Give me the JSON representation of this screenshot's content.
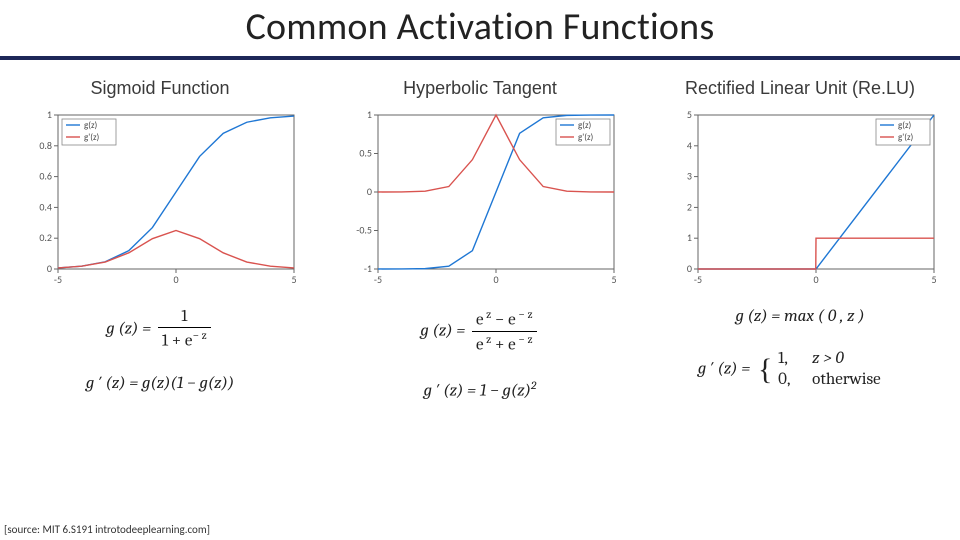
{
  "title": "Common Activation Functions",
  "source": "[source: MIT 6.S191 introtodeeplearning.com]",
  "legend": {
    "g": "g(z)",
    "gp": "g'(z)"
  },
  "panels": {
    "sigmoid": {
      "title": "Sigmoid Function",
      "formula_g_lhs": "g (z) = ",
      "formula_g_num": "1",
      "formula_g_den_pre": "1 + e",
      "formula_g_den_sup": "− z",
      "formula_gp": "g ′ (z) =  g(z)(1 − g(z))"
    },
    "tanh": {
      "title": "Hyperbolic Tangent",
      "formula_g_lhs": "g (z) = ",
      "formula_g_num_a": "e",
      "formula_g_num_a_sup": " z",
      "formula_g_num_mid": " − e",
      "formula_g_num_b_sup": " − z",
      "formula_g_den_a": "e",
      "formula_g_den_a_sup": " z",
      "formula_g_den_mid": " + e",
      "formula_g_den_b_sup": " − z",
      "formula_gp_pre": "g ′ (z) =  1 − g(z)",
      "formula_gp_sup": "2"
    },
    "relu": {
      "title": "Rectified Linear Unit (Re.LU)",
      "formula_g": "g (z) =  max ( 0 , z )",
      "formula_gp_lhs": "g ′ (z) = ",
      "cases_1_val": "1,",
      "cases_1_cond": "z > 0",
      "cases_0_val": "0,",
      "cases_0_cond": "otherwise"
    }
  },
  "chart_data": [
    {
      "type": "line",
      "title": "Sigmoid Function",
      "xlabel": "",
      "ylabel": "",
      "xlim": [
        -5,
        5
      ],
      "ylim": [
        0,
        1
      ],
      "xticks": [
        -5,
        0,
        5
      ],
      "yticks": [
        0,
        0.2,
        0.4,
        0.6,
        0.8,
        1
      ],
      "legend": [
        "g(z)",
        "g'(z)"
      ],
      "series": [
        {
          "name": "g(z)",
          "x": [
            -5,
            -4,
            -3,
            -2,
            -1,
            0,
            1,
            2,
            3,
            4,
            5
          ],
          "y": [
            0.007,
            0.018,
            0.047,
            0.119,
            0.269,
            0.5,
            0.731,
            0.881,
            0.953,
            0.982,
            0.993
          ]
        },
        {
          "name": "g'(z)",
          "x": [
            -5,
            -4,
            -3,
            -2,
            -1,
            0,
            1,
            2,
            3,
            4,
            5
          ],
          "y": [
            0.007,
            0.018,
            0.045,
            0.105,
            0.197,
            0.25,
            0.197,
            0.105,
            0.045,
            0.018,
            0.007
          ]
        }
      ]
    },
    {
      "type": "line",
      "title": "Hyperbolic Tangent",
      "xlabel": "",
      "ylabel": "",
      "xlim": [
        -5,
        5
      ],
      "ylim": [
        -1,
        1
      ],
      "xticks": [
        -5,
        0,
        5
      ],
      "yticks": [
        -1,
        -0.5,
        0,
        0.5,
        1
      ],
      "legend": [
        "g(z)",
        "g'(z)"
      ],
      "series": [
        {
          "name": "g(z)",
          "x": [
            -5,
            -4,
            -3,
            -2,
            -1,
            0,
            1,
            2,
            3,
            4,
            5
          ],
          "y": [
            -1.0,
            -0.999,
            -0.995,
            -0.964,
            -0.762,
            0.0,
            0.762,
            0.964,
            0.995,
            0.999,
            1.0
          ]
        },
        {
          "name": "g'(z)",
          "x": [
            -5,
            -4,
            -3,
            -2,
            -1,
            0,
            1,
            2,
            3,
            4,
            5
          ],
          "y": [
            0.0,
            0.001,
            0.01,
            0.071,
            0.42,
            1.0,
            0.42,
            0.071,
            0.01,
            0.001,
            0.0
          ]
        }
      ]
    },
    {
      "type": "line",
      "title": "Rectified Linear Unit (ReLU)",
      "xlabel": "",
      "ylabel": "",
      "xlim": [
        -5,
        5
      ],
      "ylim": [
        0,
        5
      ],
      "xticks": [
        -5,
        0,
        5
      ],
      "yticks": [
        0,
        1,
        2,
        3,
        4,
        5
      ],
      "legend": [
        "g(z)",
        "g'(z)"
      ],
      "series": [
        {
          "name": "g(z)",
          "x": [
            -5,
            0,
            5
          ],
          "y": [
            0,
            0,
            5
          ]
        },
        {
          "name": "g'(z)",
          "x": [
            -5,
            -0.01,
            0,
            5
          ],
          "y": [
            0,
            0,
            1,
            1
          ]
        }
      ]
    }
  ]
}
